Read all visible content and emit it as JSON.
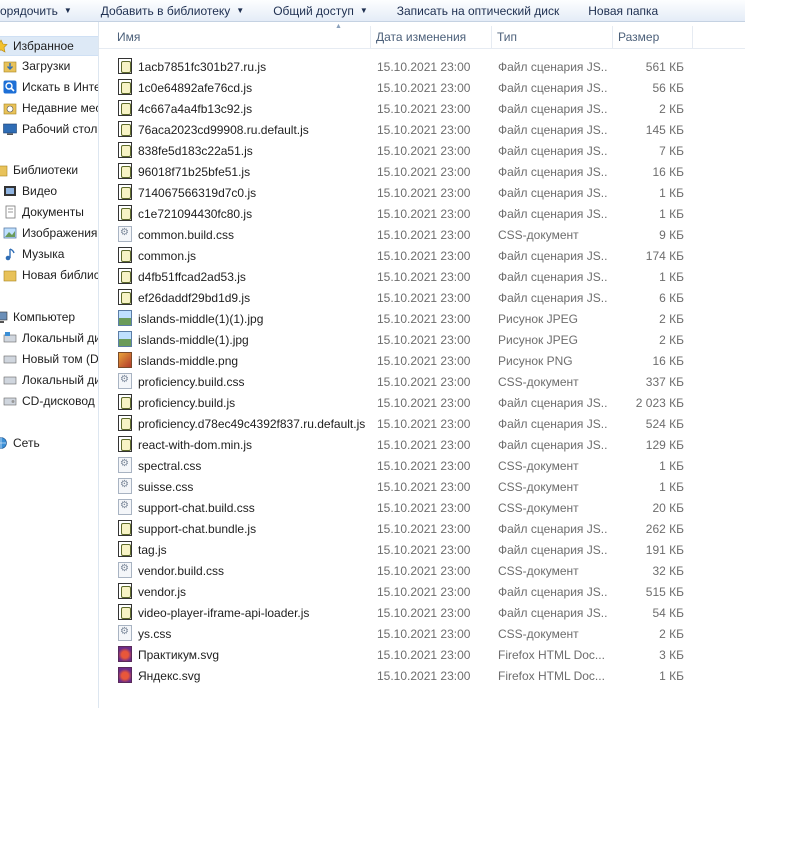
{
  "toolbar": {
    "organize": "орядочить",
    "add_to_library": "Добавить в библиотеку",
    "share": "Общий доступ",
    "burn": "Записать на оптический диск",
    "new_folder": "Новая папка"
  },
  "nav": {
    "favorites": "Избранное",
    "downloads": "Загрузки",
    "search_internet": "Искать в Инте",
    "recent": "Недавние мес",
    "desktop": "Рабочий стол",
    "libraries": "Библиотеки",
    "video": "Видео",
    "documents": "Документы",
    "images": "Изображения",
    "music": "Музыка",
    "new_library": "Новая библис",
    "computer": "Компьютер",
    "local_disk_1": "Локальный ди",
    "new_volume": "Новый том (D",
    "local_disk_2": "Локальный ди",
    "cd_drive": "CD-дисковод",
    "network": "Сеть"
  },
  "columns": {
    "name": "Имя",
    "date": "Дата изменения",
    "type": "Тип",
    "size": "Размер"
  },
  "files": [
    {
      "name": "1acb7851fc301b27.ru.js",
      "date": "15.10.2021 23:00",
      "type": "Файл сценария JS...",
      "size": "561 КБ",
      "icon": "js"
    },
    {
      "name": "1c0e64892afe76cd.js",
      "date": "15.10.2021 23:00",
      "type": "Файл сценария JS...",
      "size": "56 КБ",
      "icon": "js"
    },
    {
      "name": "4c667a4a4fb13c92.js",
      "date": "15.10.2021 23:00",
      "type": "Файл сценария JS...",
      "size": "2 КБ",
      "icon": "js"
    },
    {
      "name": "76aca2023cd99908.ru.default.js",
      "date": "15.10.2021 23:00",
      "type": "Файл сценария JS...",
      "size": "145 КБ",
      "icon": "js"
    },
    {
      "name": "838fe5d183c22a51.js",
      "date": "15.10.2021 23:00",
      "type": "Файл сценария JS...",
      "size": "7 КБ",
      "icon": "js"
    },
    {
      "name": "96018f71b25bfe51.js",
      "date": "15.10.2021 23:00",
      "type": "Файл сценария JS...",
      "size": "16 КБ",
      "icon": "js"
    },
    {
      "name": "714067566319d7c0.js",
      "date": "15.10.2021 23:00",
      "type": "Файл сценария JS...",
      "size": "1 КБ",
      "icon": "js"
    },
    {
      "name": "c1e721094430fc80.js",
      "date": "15.10.2021 23:00",
      "type": "Файл сценария JS...",
      "size": "1 КБ",
      "icon": "js"
    },
    {
      "name": "common.build.css",
      "date": "15.10.2021 23:00",
      "type": "CSS-документ",
      "size": "9 КБ",
      "icon": "css"
    },
    {
      "name": "common.js",
      "date": "15.10.2021 23:00",
      "type": "Файл сценария JS...",
      "size": "174 КБ",
      "icon": "js"
    },
    {
      "name": "d4fb51ffcad2ad53.js",
      "date": "15.10.2021 23:00",
      "type": "Файл сценария JS...",
      "size": "1 КБ",
      "icon": "js"
    },
    {
      "name": "ef26daddf29bd1d9.js",
      "date": "15.10.2021 23:00",
      "type": "Файл сценария JS...",
      "size": "6 КБ",
      "icon": "js"
    },
    {
      "name": "islands-middle(1)(1).jpg",
      "date": "15.10.2021 23:00",
      "type": "Рисунок JPEG",
      "size": "2 КБ",
      "icon": "jpg"
    },
    {
      "name": "islands-middle(1).jpg",
      "date": "15.10.2021 23:00",
      "type": "Рисунок JPEG",
      "size": "2 КБ",
      "icon": "jpg"
    },
    {
      "name": "islands-middle.png",
      "date": "15.10.2021 23:00",
      "type": "Рисунок PNG",
      "size": "16 КБ",
      "icon": "png"
    },
    {
      "name": "proficiency.build.css",
      "date": "15.10.2021 23:00",
      "type": "CSS-документ",
      "size": "337 КБ",
      "icon": "css"
    },
    {
      "name": "proficiency.build.js",
      "date": "15.10.2021 23:00",
      "type": "Файл сценария JS...",
      "size": "2 023 КБ",
      "icon": "js"
    },
    {
      "name": "proficiency.d78ec49c4392f837.ru.default.js",
      "date": "15.10.2021 23:00",
      "type": "Файл сценария JS...",
      "size": "524 КБ",
      "icon": "js"
    },
    {
      "name": "react-with-dom.min.js",
      "date": "15.10.2021 23:00",
      "type": "Файл сценария JS...",
      "size": "129 КБ",
      "icon": "js"
    },
    {
      "name": "spectral.css",
      "date": "15.10.2021 23:00",
      "type": "CSS-документ",
      "size": "1 КБ",
      "icon": "css"
    },
    {
      "name": "suisse.css",
      "date": "15.10.2021 23:00",
      "type": "CSS-документ",
      "size": "1 КБ",
      "icon": "css"
    },
    {
      "name": "support-chat.build.css",
      "date": "15.10.2021 23:00",
      "type": "CSS-документ",
      "size": "20 КБ",
      "icon": "css"
    },
    {
      "name": "support-chat.bundle.js",
      "date": "15.10.2021 23:00",
      "type": "Файл сценария JS...",
      "size": "262 КБ",
      "icon": "js"
    },
    {
      "name": "tag.js",
      "date": "15.10.2021 23:00",
      "type": "Файл сценария JS...",
      "size": "191 КБ",
      "icon": "js"
    },
    {
      "name": "vendor.build.css",
      "date": "15.10.2021 23:00",
      "type": "CSS-документ",
      "size": "32 КБ",
      "icon": "css"
    },
    {
      "name": "vendor.js",
      "date": "15.10.2021 23:00",
      "type": "Файл сценария JS...",
      "size": "515 КБ",
      "icon": "js"
    },
    {
      "name": "video-player-iframe-api-loader.js",
      "date": "15.10.2021 23:00",
      "type": "Файл сценария JS...",
      "size": "54 КБ",
      "icon": "js"
    },
    {
      "name": "ys.css",
      "date": "15.10.2021 23:00",
      "type": "CSS-документ",
      "size": "2 КБ",
      "icon": "css"
    },
    {
      "name": "Практикум.svg",
      "date": "15.10.2021 23:00",
      "type": "Firefox HTML Doc...",
      "size": "3 КБ",
      "icon": "svg"
    },
    {
      "name": "Яндекс.svg",
      "date": "15.10.2021 23:00",
      "type": "Firefox HTML Doc...",
      "size": "1 КБ",
      "icon": "svg"
    }
  ]
}
